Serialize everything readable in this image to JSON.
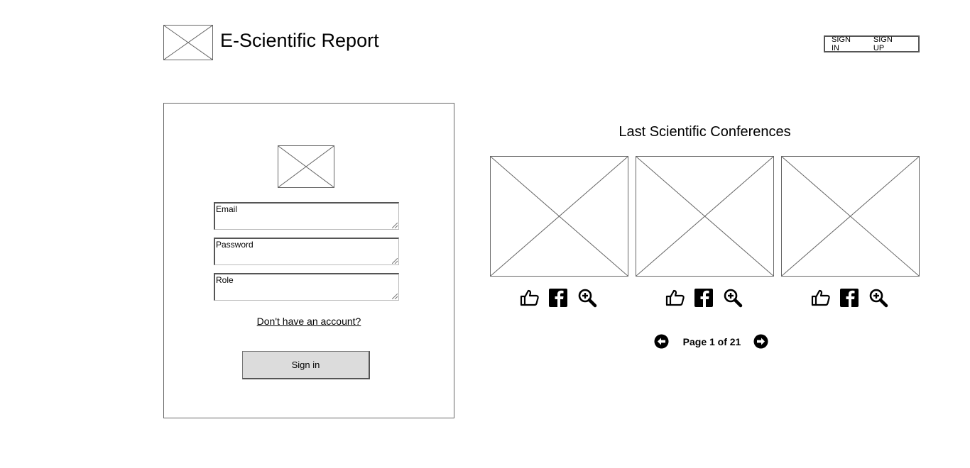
{
  "header": {
    "title": "E-Scientific Report",
    "sign_in": "SIGN IN",
    "sign_up": "SIGN UP"
  },
  "login": {
    "email_placeholder": "Email",
    "password_placeholder": "Password",
    "role_placeholder": "Role",
    "signup_link": "Don't have an account?",
    "signin_button": "Sign in"
  },
  "conferences": {
    "title": "Last Scientific Conferences",
    "item_count": 3,
    "item_icons": [
      "thumbs-up-icon",
      "facebook-icon",
      "zoom-in-icon"
    ]
  },
  "pagination": {
    "text": "Page 1 of 21",
    "current_page": 1,
    "total_pages": 21
  }
}
